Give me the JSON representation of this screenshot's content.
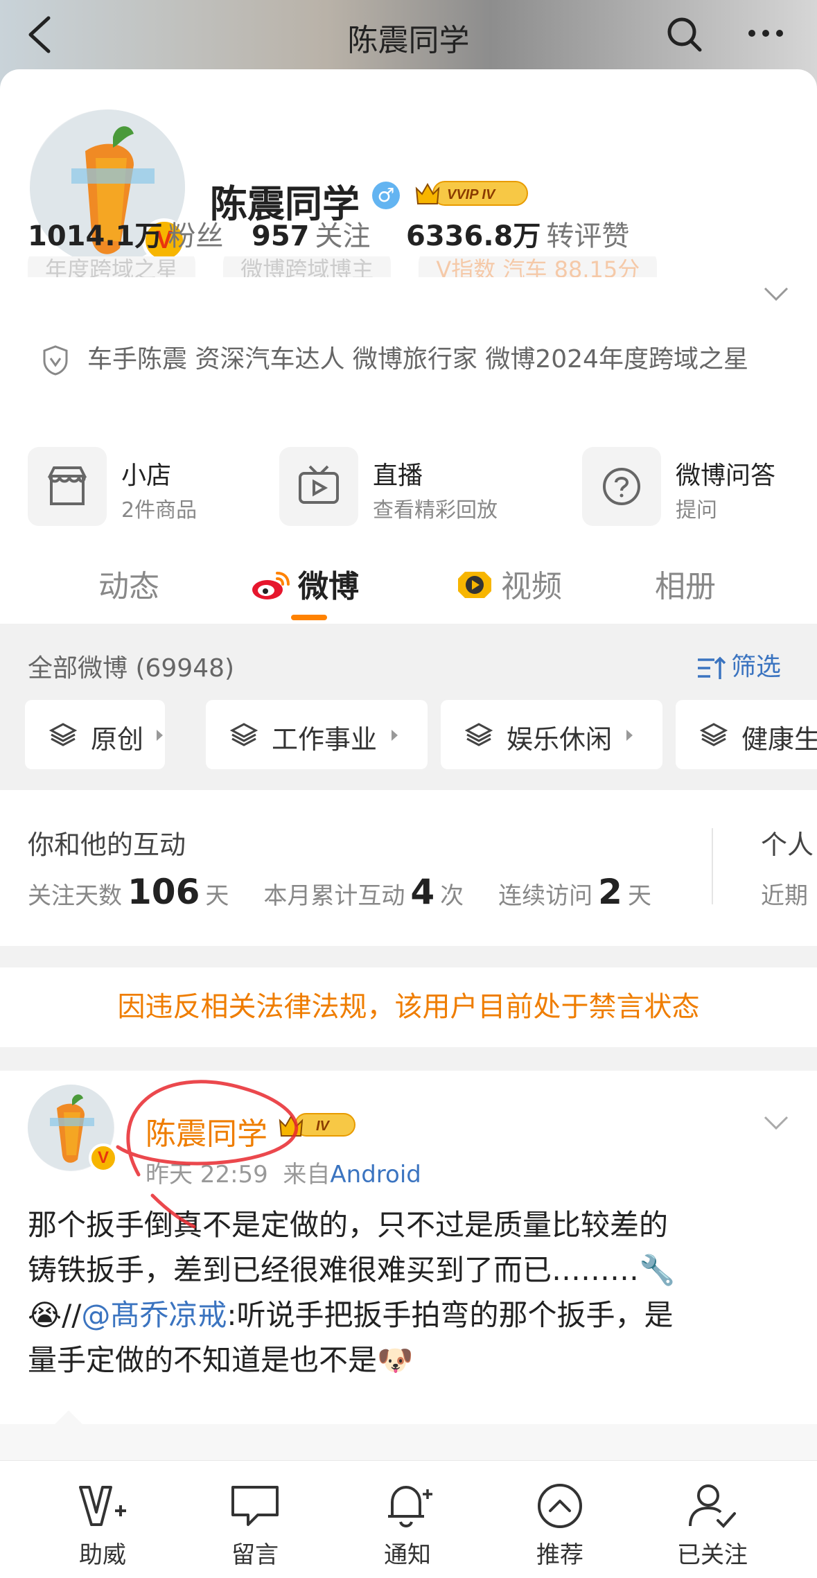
{
  "topbar": {
    "title": "陈震同学"
  },
  "profile": {
    "name": "陈震同学",
    "gender_symbol": "♂",
    "vip_badge": "VVIP IV",
    "verified_mark": "V",
    "stats": [
      {
        "num": "1014.1万",
        "label": "粉丝"
      },
      {
        "num": "957",
        "label": "关注"
      },
      {
        "num": "6336.8万",
        "label": "转评赞"
      }
    ],
    "faded_tags": [
      "年度跨域之星",
      "微博跨域博主",
      "V指数 汽车 88.15分"
    ],
    "description": "车手陈震 资深汽车达人  微博旅行家 微博2024年度跨域之星",
    "services": [
      {
        "title": "小店",
        "subtitle": "2件商品",
        "icon": "shop-icon"
      },
      {
        "title": "直播",
        "subtitle": "查看精彩回放",
        "icon": "live-tv-icon"
      },
      {
        "title": "微博问答",
        "subtitle": "提问",
        "icon": "question-icon"
      }
    ]
  },
  "tabs": [
    {
      "label": "动态"
    },
    {
      "label": "微博"
    },
    {
      "label": "视频"
    },
    {
      "label": "相册"
    }
  ],
  "filter": {
    "all_count": "全部微博 (69948)",
    "filter_label": "筛选",
    "chips": [
      "原创",
      "工作事业",
      "娱乐休闲",
      "健康生"
    ]
  },
  "interaction": {
    "heading": "你和他的互动",
    "follow_days_label": "关注天数",
    "follow_days": "106",
    "day_unit": "天",
    "month_label": "本月累计互动",
    "month_count": "4",
    "times_unit": "次",
    "visit_label": "连续访问",
    "visit_days": "2",
    "heading2": "个人",
    "row2": "近期"
  },
  "ban_notice": "因违反相关法律法规，该用户目前处于禁言状态",
  "post": {
    "author": "陈震同学",
    "vip_level": "IV",
    "time": "昨天 22:59",
    "from_label": "来自",
    "source": "Android",
    "text_line1": "那个扳手倒真不是定做的，只不过是质量比较差的",
    "text_line2": "铸铁扳手，差到已经很难很难买到了而已………🔧",
    "text_line3_emoji": "😭",
    "text_line3_pre": "//",
    "mention": "@髙乔凉戒",
    "text_line3_post": ":听说手把扳手拍弯的那个扳手，是",
    "text_line4": "量手定做的不知道是也不是🐶"
  },
  "bottom_nav": [
    {
      "label": "助威",
      "icon": "cheer-icon"
    },
    {
      "label": "留言",
      "icon": "message-icon"
    },
    {
      "label": "通知",
      "icon": "bell-icon"
    },
    {
      "label": "推荐",
      "icon": "recommend-icon"
    },
    {
      "label": "已关注",
      "icon": "followed-icon"
    }
  ],
  "colors": {
    "accent": "#ff8200",
    "link": "#3b74c0",
    "orange_text": "#ef7d00"
  }
}
